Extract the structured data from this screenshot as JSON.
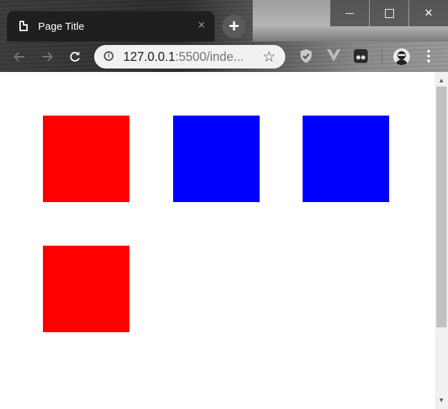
{
  "browser": {
    "tab_title": "Page Title",
    "tab_close_glyph": "×",
    "new_tab_glyph": "+",
    "url_host": "127.0.0.1",
    "url_rest": ":5500/inde...",
    "window_controls": {
      "minimize": "minimize-icon",
      "maximize": "maximize-icon",
      "close": "×"
    }
  },
  "content": {
    "squares": [
      {
        "color": "#ff0000"
      },
      {
        "color": "#0000ff"
      },
      {
        "color": "#0000ff"
      },
      {
        "color": "#ff0000"
      }
    ]
  },
  "colors": {
    "red": "#ff0000",
    "blue": "#0000ff"
  }
}
